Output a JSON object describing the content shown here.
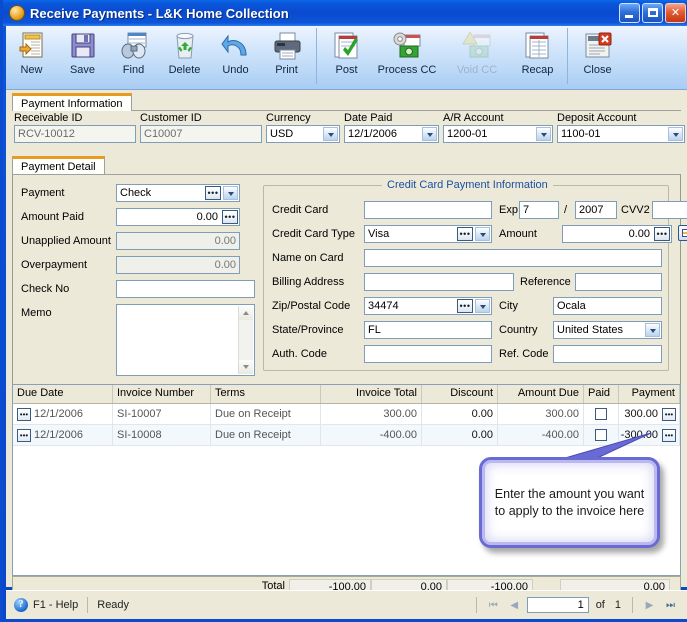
{
  "window": {
    "title": "Receive Payments - L&K Home Collection",
    "app_icon": "orb-icon",
    "controls": {
      "minimize": "Minimize",
      "maximize": "Maximize",
      "close": "Close"
    }
  },
  "toolbar": {
    "items": [
      {
        "label": "New",
        "icon": "new-document-icon",
        "enabled": true
      },
      {
        "label": "Save",
        "icon": "floppy-disk-icon",
        "enabled": true
      },
      {
        "label": "Find",
        "icon": "binoculars-icon",
        "enabled": true
      },
      {
        "label": "Delete",
        "icon": "recycle-bin-icon",
        "enabled": true
      },
      {
        "label": "Undo",
        "icon": "undo-arrow-icon",
        "enabled": true
      },
      {
        "label": "Print",
        "icon": "printer-icon",
        "enabled": true
      },
      {
        "label": "Post",
        "icon": "document-check-icon",
        "enabled": true
      },
      {
        "label": "Process CC",
        "icon": "gear-card-icon",
        "enabled": true
      },
      {
        "label": "Void CC",
        "icon": "warning-card-icon",
        "enabled": false
      },
      {
        "label": "Recap",
        "icon": "report-icon",
        "enabled": true
      },
      {
        "label": "Close",
        "icon": "document-close-icon",
        "enabled": true
      }
    ]
  },
  "tabs": {
    "payment_information": "Payment Information",
    "payment_detail": "Payment Detail"
  },
  "header_fields": {
    "receivable_id": {
      "label": "Receivable ID",
      "value": "RCV-10012"
    },
    "customer_id": {
      "label": "Customer ID",
      "value": "C10007"
    },
    "currency": {
      "label": "Currency",
      "value": "USD"
    },
    "date_paid": {
      "label": "Date Paid",
      "value": "12/1/2006"
    },
    "ar_account": {
      "label": "A/R Account",
      "value": "1200-01"
    },
    "deposit_account": {
      "label": "Deposit Account",
      "value": "1100-01"
    }
  },
  "payment_detail": {
    "payment": {
      "label": "Payment",
      "value": "Check"
    },
    "amount_paid": {
      "label": "Amount Paid",
      "value": "0.00"
    },
    "unapplied_amount": {
      "label": "Unapplied Amount",
      "value": "0.00"
    },
    "overpayment": {
      "label": "Overpayment",
      "value": "0.00"
    },
    "check_no": {
      "label": "Check No",
      "value": ""
    },
    "memo": {
      "label": "Memo",
      "value": ""
    }
  },
  "credit_card": {
    "legend": "Credit Card Payment Information",
    "credit_card": {
      "label": "Credit Card",
      "value": ""
    },
    "exp": {
      "label": "Exp",
      "month": "7",
      "separator": "/",
      "year": "2007"
    },
    "cvv2": {
      "label": "CVV2",
      "value": ""
    },
    "card_type": {
      "label": "Credit Card Type",
      "value": "Visa"
    },
    "amount": {
      "label": "Amount",
      "value": "0.00"
    },
    "name_on_card": {
      "label": "Name on Card",
      "value": ""
    },
    "billing_address": {
      "label": "Billing Address",
      "value": ""
    },
    "reference": {
      "label": "Reference",
      "value": ""
    },
    "zip": {
      "label": "Zip/Postal Code",
      "value": "34474"
    },
    "city": {
      "label": "City",
      "value": "Ocala"
    },
    "state": {
      "label": "State/Province",
      "value": "FL"
    },
    "country": {
      "label": "Country",
      "value": "United States"
    },
    "auth_code": {
      "label": "Auth. Code",
      "value": ""
    },
    "ref_code": {
      "label": "Ref. Code",
      "value": ""
    },
    "charge_button_icon": "credit-card-icon"
  },
  "grid": {
    "columns": [
      "Due Date",
      "Invoice Number",
      "Terms",
      "Invoice Total",
      "Discount",
      "Amount Due",
      "Paid",
      "Payment"
    ],
    "rows": [
      {
        "due_date": "12/1/2006",
        "invoice_number": "SI-10007",
        "terms": "Due on Receipt",
        "invoice_total": "300.00",
        "discount": "0.00",
        "amount_due": "300.00",
        "paid": false,
        "payment": "300.00"
      },
      {
        "due_date": "12/1/2006",
        "invoice_number": "SI-10008",
        "terms": "Due on Receipt",
        "invoice_total": "-400.00",
        "discount": "0.00",
        "amount_due": "-400.00",
        "paid": false,
        "payment": "-300.00"
      }
    ],
    "totals": {
      "label": "Total",
      "invoice_total": "-100.00",
      "discount": "0.00",
      "amount_due": "-100.00",
      "payment": "0.00"
    }
  },
  "callout": {
    "text": "Enter the amount you want to apply to the invoice here",
    "border_color": "#6a6ad4"
  },
  "status_bar": {
    "help": "F1 - Help",
    "state": "Ready",
    "page_value": "1",
    "of_label": "of",
    "page_count": "1",
    "first_icon": "first-page-icon",
    "prev_icon": "previous-page-icon",
    "next_icon": "next-page-icon",
    "last_icon": "last-page-icon"
  },
  "colors": {
    "title_bar": "#0a4ad0",
    "panel": "#ece9d8",
    "tab_accent": "#e89b22",
    "legend_blue": "#1d4fa0"
  }
}
